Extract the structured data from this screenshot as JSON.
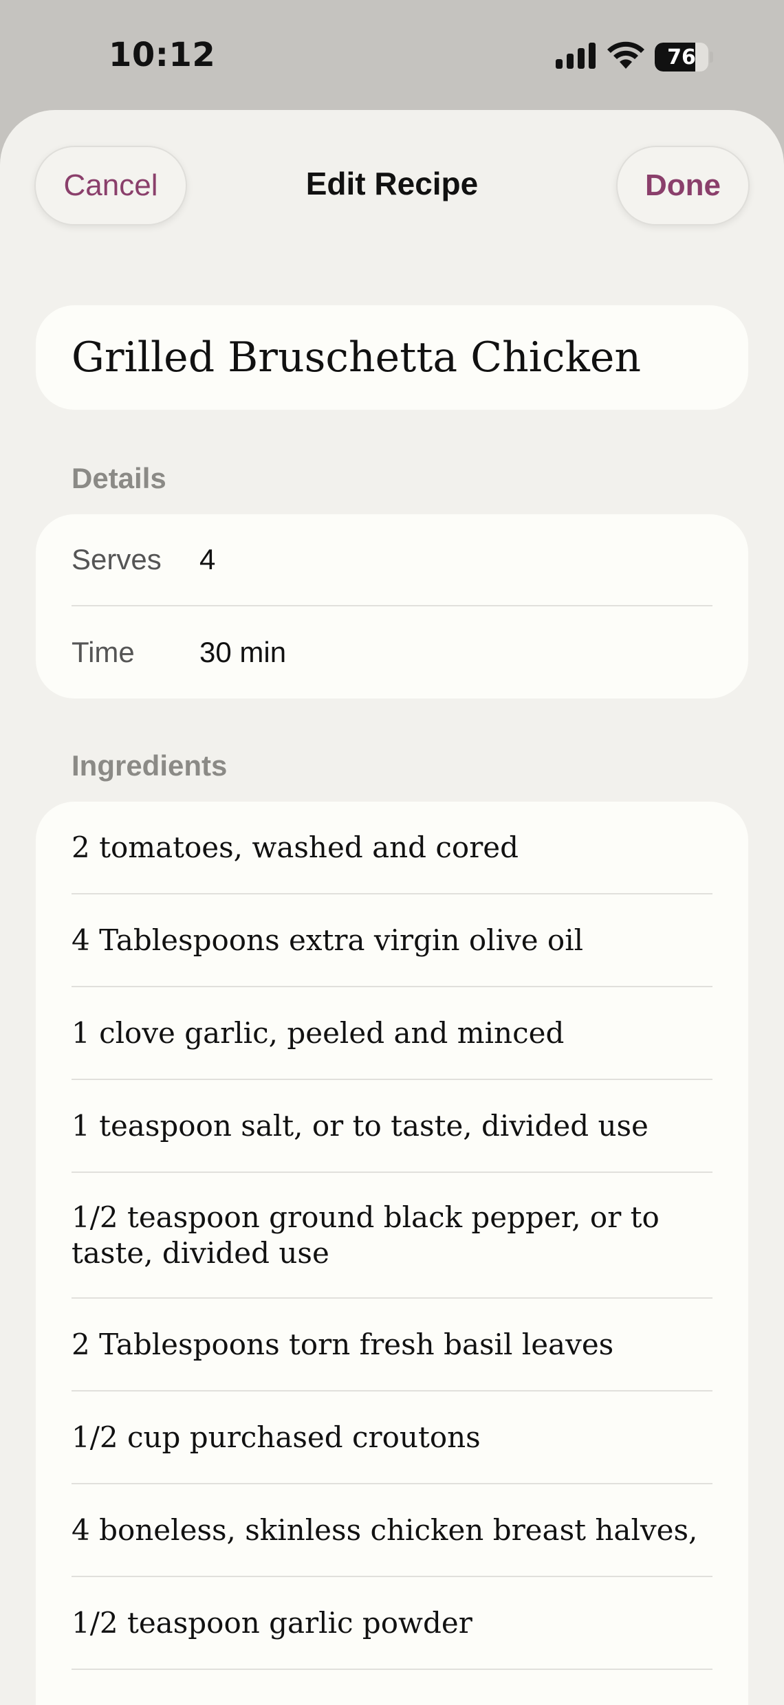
{
  "status_bar": {
    "time": "10:12",
    "battery_percent": "76",
    "battery_level": 0.76
  },
  "nav": {
    "cancel_label": "Cancel",
    "title": "Edit Recipe",
    "done_label": "Done",
    "accent_color": "#8a3f6b"
  },
  "recipe": {
    "title": "Grilled Bruschetta Chicken"
  },
  "details": {
    "section_label": "Details",
    "serves_label": "Serves",
    "serves_value": "4",
    "time_label": "Time",
    "time_value": "30 min"
  },
  "ingredients": {
    "section_label": "Ingredients",
    "items": [
      "2 tomatoes, washed and cored",
      "4 Tablespoons extra virgin olive oil",
      "1 clove garlic, peeled and minced",
      "1 teaspoon salt, or to taste, divided use",
      "1/2 teaspoon ground black pepper, or to taste, divided use",
      "2 Tablespoons torn fresh basil leaves",
      "1/2 cup purchased croutons",
      "4 boneless, skinless chicken breast halves,",
      "1/2 teaspoon garlic powder"
    ]
  },
  "icons": [
    "signal-icon",
    "wifi-icon",
    "battery-icon"
  ]
}
